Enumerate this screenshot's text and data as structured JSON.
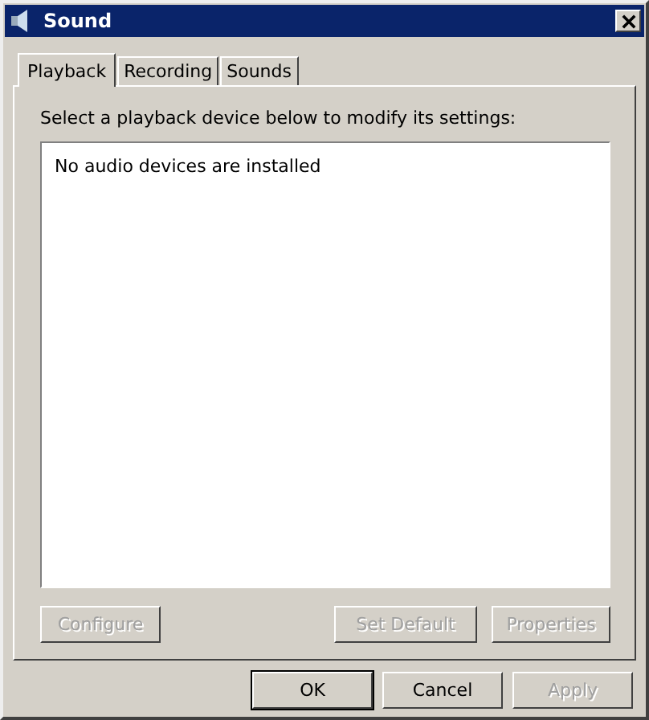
{
  "window": {
    "title": "Sound"
  },
  "tabs": [
    {
      "label": "Playback",
      "selected": true
    },
    {
      "label": "Recording",
      "selected": false
    },
    {
      "label": "Sounds",
      "selected": false
    }
  ],
  "instruction": "Select a playback device below to modify its settings:",
  "device_list": {
    "empty_message": "No audio devices are installed"
  },
  "device_buttons": [
    {
      "label": "Configure",
      "disabled": true
    },
    {
      "label": "Set Default",
      "disabled": true
    },
    {
      "label": "Properties",
      "disabled": true
    }
  ],
  "dialog_buttons": [
    {
      "label": "OK",
      "disabled": false,
      "default": true
    },
    {
      "label": "Cancel",
      "disabled": false,
      "default": false
    },
    {
      "label": "Apply",
      "disabled": true,
      "default": false
    }
  ]
}
